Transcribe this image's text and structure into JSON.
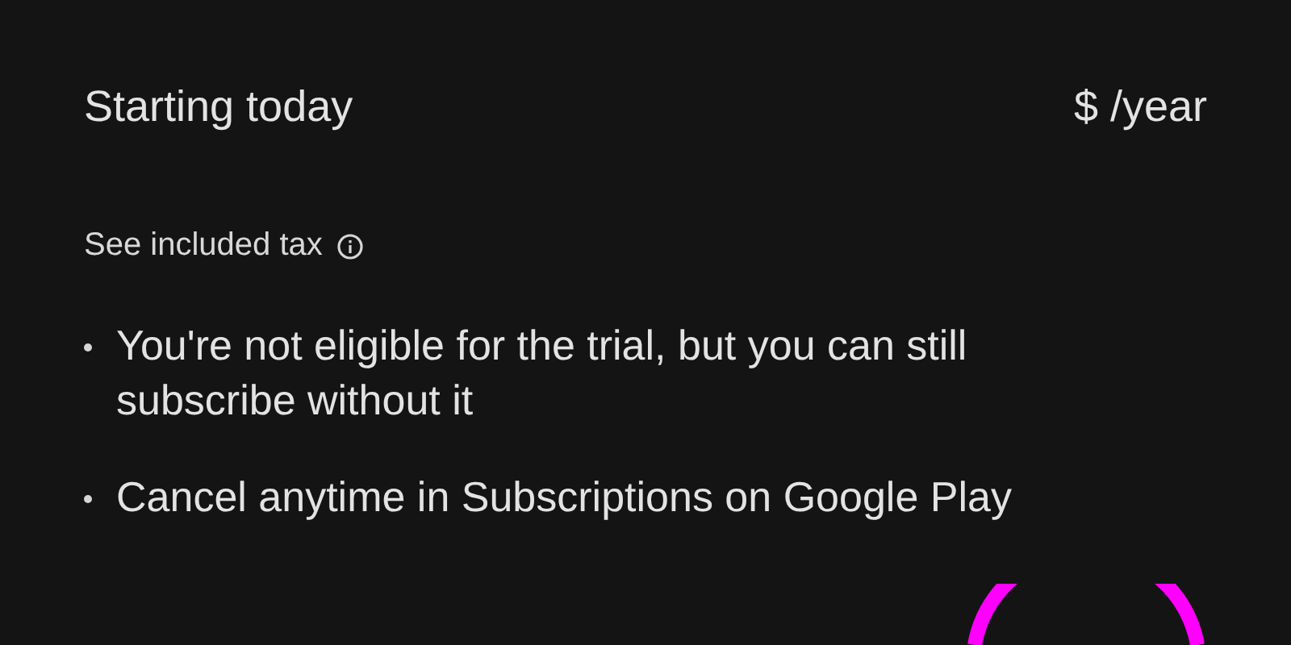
{
  "price_row": {
    "label": "Starting today",
    "price": "$ /year"
  },
  "tax_link": "See included tax",
  "bullets": [
    "You're not eligible for the trial, but you can still subscribe without it",
    "Cancel anytime in Subscriptions on Google Play"
  ]
}
